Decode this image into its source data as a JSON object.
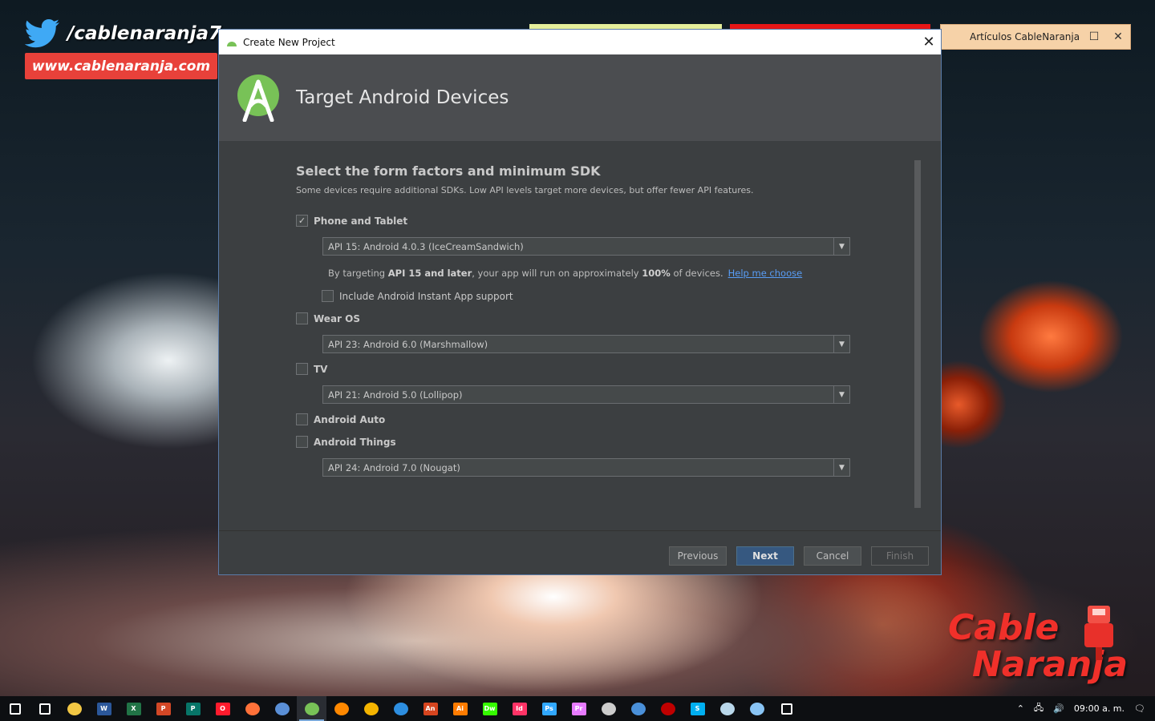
{
  "branding": {
    "twitter_handle": "/cablenaranja7",
    "website": "www.cablenaranja.com",
    "logo_line1": "Cable",
    "logo_line2": "Naranja"
  },
  "background_window": {
    "title": "Artículos CableNaranja",
    "maximize_icon": "square-icon",
    "close_icon": "close-icon"
  },
  "dialog": {
    "window_title": "Create New Project",
    "header_title": "Target Android Devices",
    "section_title": "Select the form factors and minimum SDK",
    "section_subtitle": "Some devices require additional SDKs. Low API levels target more devices, but offer fewer API features.",
    "form_factors": {
      "phone": {
        "label": "Phone and Tablet",
        "checked": true,
        "sdk": "API 15: Android 4.0.3 (IceCreamSandwich)",
        "info_prefix": "By targeting ",
        "info_bold1": "API 15 and later",
        "info_mid": ", your app will run on approximately ",
        "info_bold2": "100%",
        "info_suffix": " of devices.",
        "help_link": "Help me choose",
        "instant_app_label": "Include Android Instant App support",
        "instant_app_checked": false
      },
      "wear": {
        "label": "Wear OS",
        "checked": false,
        "sdk": "API 23: Android 6.0 (Marshmallow)"
      },
      "tv": {
        "label": "TV",
        "checked": false,
        "sdk": "API 21: Android 5.0 (Lollipop)"
      },
      "auto": {
        "label": "Android Auto",
        "checked": false
      },
      "things": {
        "label": "Android Things",
        "checked": false,
        "sdk": "API 24: Android 7.0 (Nougat)"
      }
    },
    "buttons": {
      "previous": "Previous",
      "next": "Next",
      "cancel": "Cancel",
      "finish": "Finish"
    }
  },
  "taskbar": {
    "icons": [
      {
        "name": "windows-start-icon",
        "label": "",
        "color": "#ffffff"
      },
      {
        "name": "task-view-icon",
        "label": "",
        "color": "#ffffff"
      },
      {
        "name": "file-explorer-icon",
        "label": "",
        "color": "#f2c744"
      },
      {
        "name": "word-icon",
        "label": "W",
        "color": "#2b579a"
      },
      {
        "name": "excel-icon",
        "label": "X",
        "color": "#217346"
      },
      {
        "name": "powerpoint-icon",
        "label": "P",
        "color": "#d24726"
      },
      {
        "name": "publisher-icon",
        "label": "P",
        "color": "#077568"
      },
      {
        "name": "opera-icon",
        "label": "O",
        "color": "#ff1b2d"
      },
      {
        "name": "firefox-icon",
        "label": "",
        "color": "#ff7139"
      },
      {
        "name": "virtualbox-icon",
        "label": "",
        "color": "#5a8fd6"
      },
      {
        "name": "android-studio-icon",
        "label": "",
        "color": "#78c257"
      },
      {
        "name": "vlc-icon",
        "label": "",
        "color": "#ff8800"
      },
      {
        "name": "gallery-icon",
        "label": "",
        "color": "#f4b400"
      },
      {
        "name": "layers-icon",
        "label": "",
        "color": "#2d8ee0"
      },
      {
        "name": "animate-icon",
        "label": "An",
        "color": "#d6451f"
      },
      {
        "name": "illustrator-icon",
        "label": "Ai",
        "color": "#ff7c00"
      },
      {
        "name": "dreamweaver-icon",
        "label": "Dw",
        "color": "#35fa00"
      },
      {
        "name": "indesign-icon",
        "label": "Id",
        "color": "#ff3366"
      },
      {
        "name": "photoshop-icon",
        "label": "Ps",
        "color": "#31a8ff"
      },
      {
        "name": "premiere-icon",
        "label": "Pr",
        "color": "#e77bff"
      },
      {
        "name": "github-icon",
        "label": "",
        "color": "#cccccc"
      },
      {
        "name": "box-icon",
        "label": "",
        "color": "#4a90d9"
      },
      {
        "name": "filezilla-icon",
        "label": "",
        "color": "#bf0000"
      },
      {
        "name": "skype-icon",
        "label": "S",
        "color": "#00aff0"
      },
      {
        "name": "notepad-icon",
        "label": "",
        "color": "#b9d7ea"
      },
      {
        "name": "paint-icon",
        "label": "",
        "color": "#89c4f4"
      },
      {
        "name": "settings-icon",
        "label": "",
        "color": "#ffffff"
      }
    ],
    "clock": "09:00 a. m.",
    "tray_icons": [
      "chevron-up-icon",
      "network-icon",
      "volume-icon",
      "notifications-icon"
    ]
  }
}
